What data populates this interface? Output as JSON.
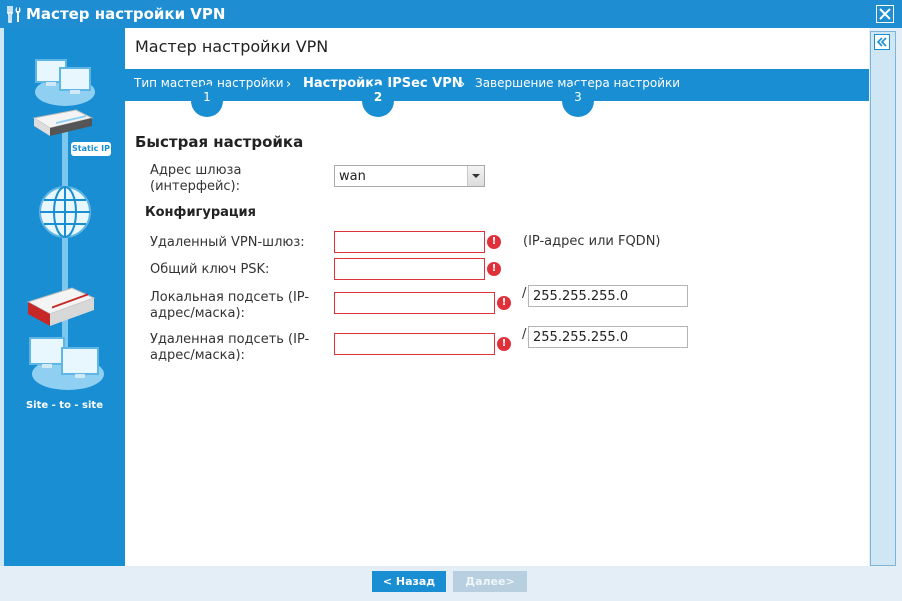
{
  "window": {
    "title": "Мастер настройки VPN"
  },
  "sidebar": {
    "static_label": "Static IP",
    "site_label": "Site - to - site"
  },
  "main": {
    "title": "Мастер настройки VPN",
    "steps": [
      {
        "label": "Тип мастера настройки",
        "number": "1"
      },
      {
        "label": "Настройка IPSec VPN",
        "number": "2"
      },
      {
        "label": "Завершение мастера настройки",
        "number": "3"
      }
    ],
    "section_title": "Быстрая настройка",
    "gateway": {
      "label_line1": "Адрес шлюза",
      "label_line2": "(интерфейс):",
      "value": "wan"
    },
    "config_title": "Конфигурация",
    "remote_gateway": {
      "label": "Удаленный VPN-шлюз:",
      "value": "",
      "hint": "(IP-адрес или FQDN)"
    },
    "psk": {
      "label": "Общий ключ PSK:",
      "value": ""
    },
    "local_subnet": {
      "label_line1": "Локальная подсеть (IP-",
      "label_line2": "адрес/маска):",
      "value": "",
      "mask": "255.255.255.0"
    },
    "remote_subnet": {
      "label_line1": "Удаленная подсеть (IP-",
      "label_line2": "адрес/маска):",
      "value": "",
      "mask": "255.255.255.0"
    },
    "slash": "/",
    "error_mark": "!"
  },
  "footer": {
    "back_label": "< Назад",
    "next_label": "Далее>"
  },
  "colors": {
    "accent": "#1a8ed3",
    "error": "#e0313a",
    "titlebar": "#1e8dd1"
  }
}
